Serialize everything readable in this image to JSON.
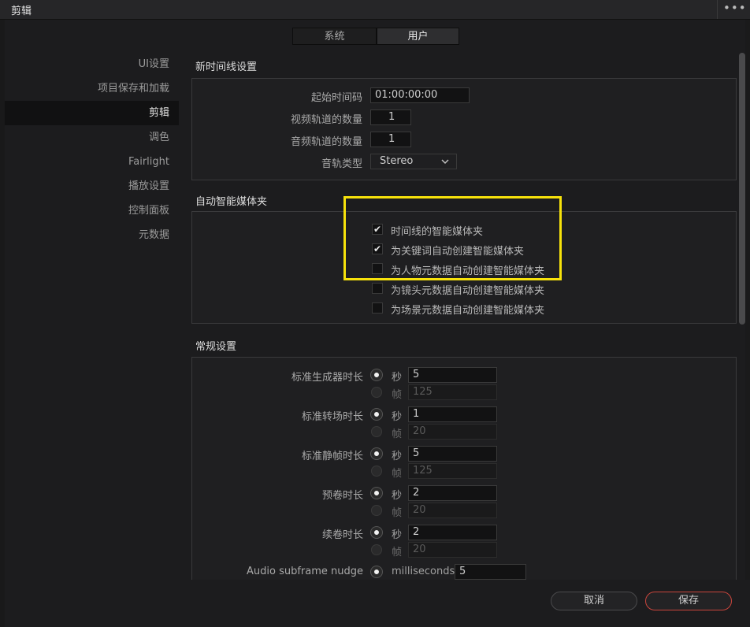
{
  "window": {
    "title": "剪辑",
    "more_label": "•••"
  },
  "tabs": [
    {
      "label": "系统",
      "active": false
    },
    {
      "label": "用户",
      "active": true
    }
  ],
  "sidebar": {
    "items": [
      {
        "label": "UI设置"
      },
      {
        "label": "项目保存和加载"
      },
      {
        "label": "剪辑",
        "active": true
      },
      {
        "label": "调色"
      },
      {
        "label": "Fairlight"
      },
      {
        "label": "播放设置"
      },
      {
        "label": "控制面板"
      },
      {
        "label": "元数据"
      }
    ]
  },
  "new_timeline": {
    "title": "新时间线设置",
    "start_timecode_label": "起始时间码",
    "start_timecode_value": "01:00:00:00",
    "video_tracks_label": "视频轨道的数量",
    "video_tracks_value": "1",
    "audio_tracks_label": "音频轨道的数量",
    "audio_tracks_value": "1",
    "audio_track_type_label": "音轨类型",
    "audio_track_type_value": "Stereo"
  },
  "smart_bins": {
    "title": "自动智能媒体夹",
    "items": [
      {
        "label": "时间线的智能媒体夹",
        "checked": true
      },
      {
        "label": "为关键词自动创建智能媒体夹",
        "checked": true
      },
      {
        "label": "为人物元数据自动创建智能媒体夹",
        "checked": false
      },
      {
        "label": "为镜头元数据自动创建智能媒体夹",
        "checked": false
      },
      {
        "label": "为场景元数据自动创建智能媒体夹",
        "checked": false
      }
    ],
    "check_glyph": "✔"
  },
  "general": {
    "title": "常规设置",
    "rows": [
      {
        "label": "标准生成器时长",
        "seconds": "5",
        "frames": "125"
      },
      {
        "label": "标准转场时长",
        "seconds": "1",
        "frames": "20"
      },
      {
        "label": "标准静帧时长",
        "seconds": "5",
        "frames": "125"
      },
      {
        "label": "预卷时长",
        "seconds": "2",
        "frames": "20"
      },
      {
        "label": "续卷时长",
        "seconds": "2",
        "frames": "20"
      }
    ],
    "seconds_unit": "秒",
    "frames_unit": "帧",
    "subframe_label": "Audio subframe nudge",
    "subframe_unit": "milliseconds",
    "subframe_value": "5"
  },
  "footer": {
    "cancel_label": "取消",
    "save_label": "保存"
  },
  "colors": {
    "highlight": "#f7e20b",
    "save_border": "#c8453c"
  }
}
